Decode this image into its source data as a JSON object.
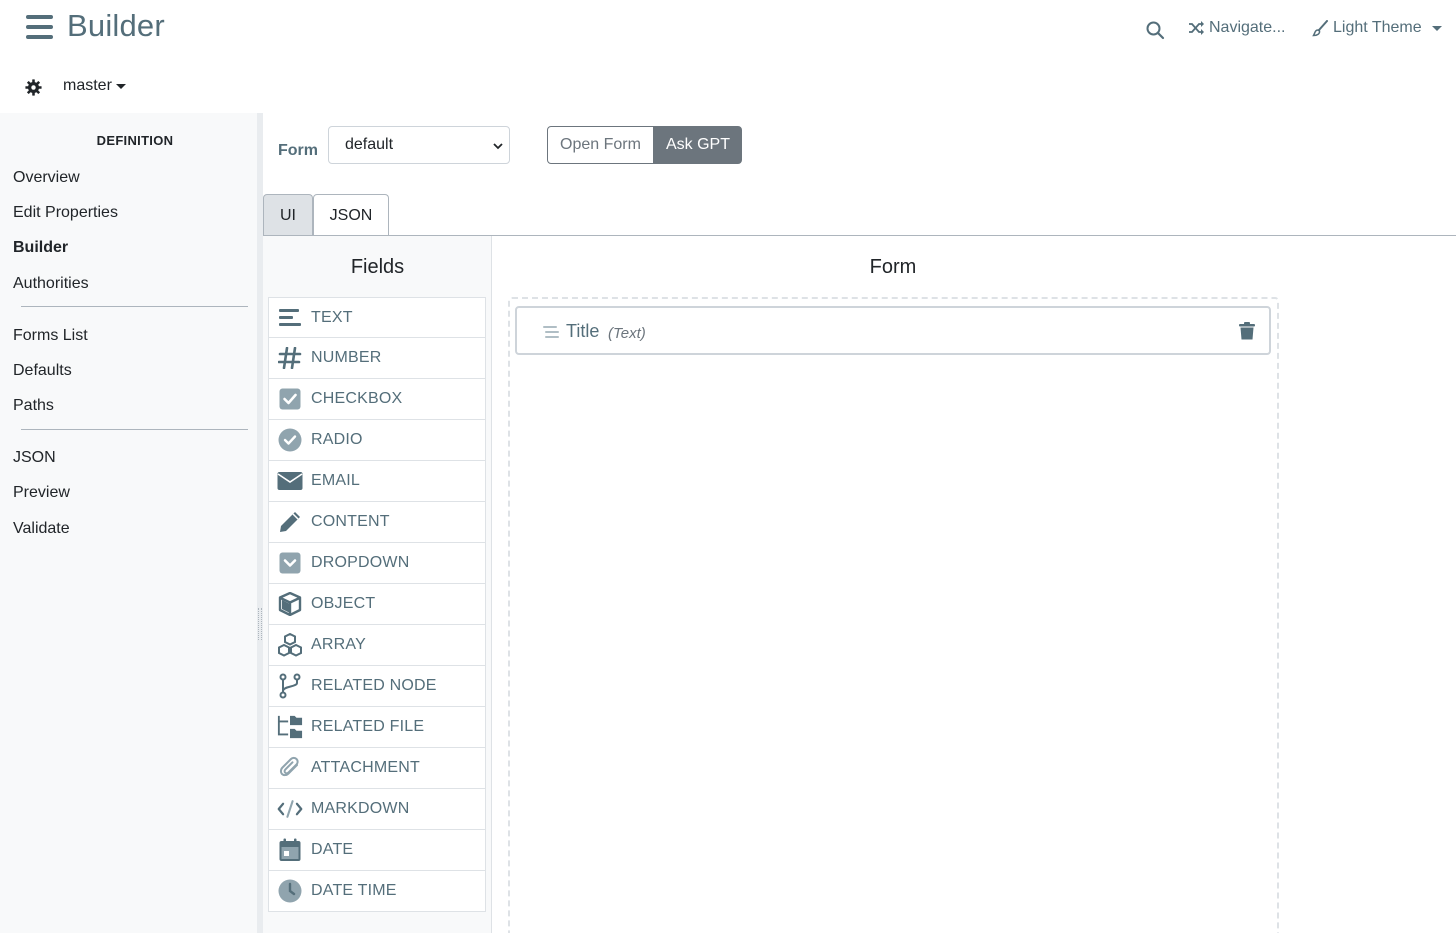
{
  "app": {
    "brand": "Builder",
    "search_icon": "search-icon",
    "navigate_label": "Navigate...",
    "theme_label": "Light Theme",
    "branch": "master"
  },
  "sidebar": {
    "heading": "DEFINITION",
    "groups": [
      [
        "Overview",
        "Edit Properties",
        "Builder",
        "Authorities"
      ],
      [
        "Forms List",
        "Defaults",
        "Paths"
      ],
      [
        "JSON",
        "Preview",
        "Validate"
      ]
    ],
    "active": "Builder"
  },
  "toolbar": {
    "form_label": "Form",
    "form_select_value": "default",
    "open_form_label": "Open Form",
    "ask_gpt_label": "Ask GPT"
  },
  "tabs": [
    {
      "label": "UI",
      "active": true
    },
    {
      "label": "JSON",
      "active": false
    }
  ],
  "fields_panel": {
    "title": "Fields",
    "items": [
      {
        "label": "TEXT",
        "icon": "text-lines-icon"
      },
      {
        "label": "NUMBER",
        "icon": "hashtag-icon"
      },
      {
        "label": "CHECKBOX",
        "icon": "checkbox-icon"
      },
      {
        "label": "RADIO",
        "icon": "radio-check-icon"
      },
      {
        "label": "EMAIL",
        "icon": "envelope-icon"
      },
      {
        "label": "CONTENT",
        "icon": "pencil-icon"
      },
      {
        "label": "DROPDOWN",
        "icon": "dropdown-icon"
      },
      {
        "label": "OBJECT",
        "icon": "cube-icon"
      },
      {
        "label": "ARRAY",
        "icon": "cubes-icon"
      },
      {
        "label": "RELATED NODE",
        "icon": "code-branch-icon"
      },
      {
        "label": "RELATED FILE",
        "icon": "folder-tree-icon"
      },
      {
        "label": "ATTACHMENT",
        "icon": "paperclip-icon"
      },
      {
        "label": "MARKDOWN",
        "icon": "code-icon"
      },
      {
        "label": "DATE",
        "icon": "calendar-icon"
      },
      {
        "label": "DATE TIME",
        "icon": "clock-icon"
      }
    ]
  },
  "form_panel": {
    "title": "Form",
    "fields": [
      {
        "title": "Title",
        "type": "(Text)"
      }
    ]
  },
  "colors": {
    "accent": "#546e7a",
    "secondary": "#6c757d",
    "sidebar_bg": "#f8f9fa"
  }
}
